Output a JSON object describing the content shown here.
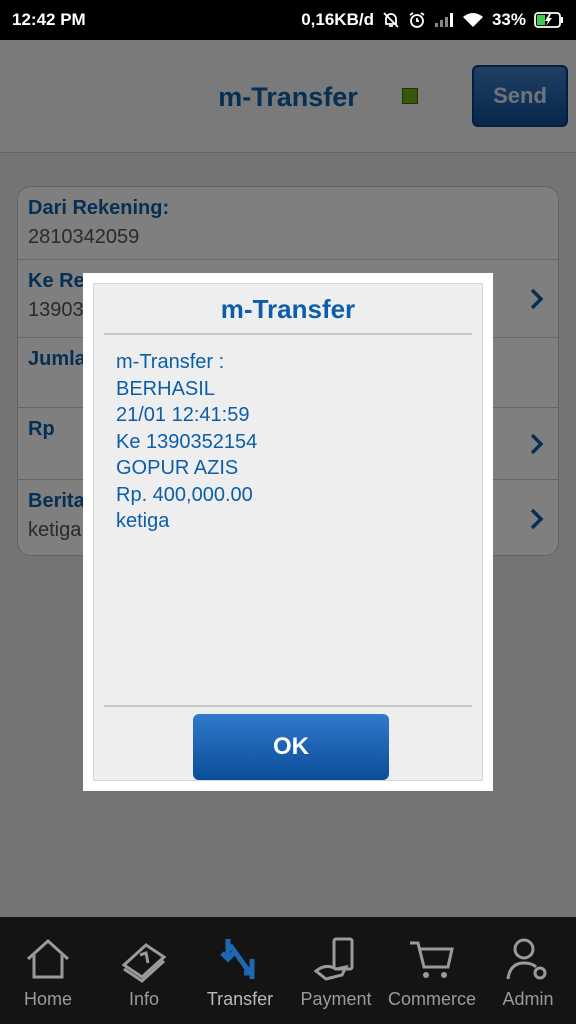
{
  "status_bar": {
    "time": "12:42 PM",
    "network_speed": "0,16KB/d",
    "battery": "33%"
  },
  "header": {
    "title": "m-Transfer",
    "send_label": "Send",
    "status_color": "#6fae16"
  },
  "form": {
    "rows": [
      {
        "label": "Dari Rekening:",
        "value": "2810342059"
      },
      {
        "label": "Ke Re",
        "value": "13903"
      },
      {
        "label": "Jumla",
        "value": ""
      },
      {
        "label": "Rp",
        "value": ""
      },
      {
        "label": "Berita",
        "value": "ketiga"
      }
    ]
  },
  "dialog": {
    "title": "m-Transfer",
    "lines": [
      "m-Transfer :",
      "BERHASIL",
      "21/01 12:41:59",
      "Ke 1390352154",
      "GOPUR AZIS",
      "Rp. 400,000.00",
      "ketiga"
    ],
    "ok_label": "OK"
  },
  "bottom_nav": {
    "items": [
      {
        "label": "Home",
        "icon": "home-icon"
      },
      {
        "label": "Info",
        "icon": "info-icon"
      },
      {
        "label": "Transfer",
        "icon": "transfer-icon"
      },
      {
        "label": "Payment",
        "icon": "payment-icon"
      },
      {
        "label": "Commerce",
        "icon": "cart-icon"
      },
      {
        "label": "Admin",
        "icon": "admin-icon"
      }
    ],
    "active": "Transfer"
  },
  "colors": {
    "brand_blue": "#0d5eaa",
    "nav_bg": "#141414"
  }
}
